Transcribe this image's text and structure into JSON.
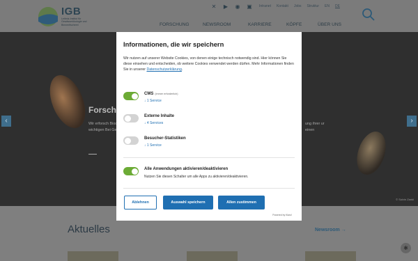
{
  "header": {
    "logo_text": "IGB",
    "logo_subtitle": "Leibniz-Institut für Gewässerökologie und Binnenfischerei",
    "toplinks": [
      "Intranet",
      "Kontakt",
      "Jobs",
      "Struktur",
      "EN",
      "DE"
    ],
    "nav": [
      "FORSCHUNG",
      "NEWSROOM",
      "KARRIERE",
      "KÖPFE",
      "ÜBER UNS"
    ]
  },
  "hero": {
    "title": "Forsch",
    "text_left": "Wir erforsch Biodiversität, wichtigen Bei Gewässerma",
    "text_right": "ung ihrer ur einen",
    "credit": "© Solvin Zankl"
  },
  "below": {
    "section_title": "Aktuelles",
    "section_link": "Newsroom →"
  },
  "modal": {
    "title": "Informationen, die wir speichern",
    "intro": "Wir nutzen auf unserer Website Cookies, von denen einige technisch notwendig sind. Hier können Sie diese einsehen und entscheiden, ob weitere Cookies verwendet werden dürfen. Mehr Informationen finden Sie in unserer ",
    "intro_link": "Datenschutzerklärung",
    "intro_end": ".",
    "services": [
      {
        "name": "CMS",
        "note": "(immer erforderlich)",
        "link": "↓ 1 Service",
        "on": true
      },
      {
        "name": "Externe Inhalte",
        "link": "↓ 4 Services",
        "on": false
      },
      {
        "name": "Besucher-Statistiken",
        "link": "↓ 1 Service",
        "on": false
      }
    ],
    "all_toggle": {
      "name": "Alle Anwendungen aktivieren/deaktivieren",
      "desc": "Nutzen Sie diesen Schalter um alle Apps zu aktivieren/deaktivieren.",
      "on": true
    },
    "buttons": {
      "decline": "Ablehnen",
      "save": "Auswahl speichern",
      "accept_all": "Allen zustimmen"
    },
    "powered_by": "Powered by Klaro!"
  },
  "colors": {
    "accent": "#1f6fb2",
    "toggle_on": "#6cab35",
    "toggle_off": "#d3d3d3",
    "overlay": "#7e7e7e"
  }
}
